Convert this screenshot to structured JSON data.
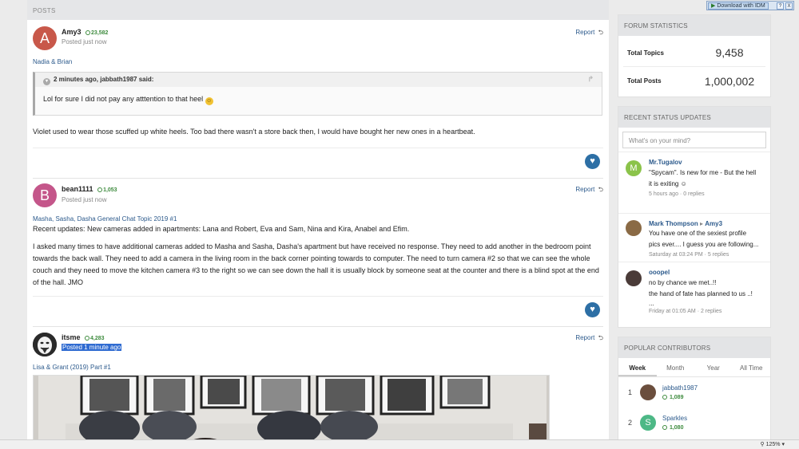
{
  "posts_section": {
    "title": "POSTS"
  },
  "posts": [
    {
      "avatar_letter": "A",
      "avatar_color": "#c8584a",
      "author": "Amy3",
      "reputation": "23,582",
      "posted": "Posted just now",
      "report_label": "Report",
      "topic": "Nadia & Brian",
      "quote": {
        "header": "2 minutes ago, jabbath1987 said:",
        "body": "Lol for sure I did not pay any atttention to that heel"
      },
      "text": "Violet used to wear those scuffed up white heels. Too bad there wasn't a store back then, I would have bought her new ones in a heartbeat."
    },
    {
      "avatar_letter": "B",
      "avatar_color": "#c4568a",
      "author": "bean1111",
      "reputation": "1,053",
      "posted": "Posted just now",
      "report_label": "Report",
      "topic": "Masha, Sasha, Dasha General Chat Topic 2019 #1",
      "text1": "Recent updates: New cameras added in apartments: Lana and Robert, Eva and Sam, Nina and Kira, Anabel and Efim.",
      "text2": "I asked many times to have additional cameras added to Masha and Sasha, Dasha's apartment but have received no response. They need to add another in the bedroom point towards the back wall. They need to add a camera in the living room in the back corner pointing towards to computer. The need to turn camera #2 so that we can see the whole couch and they need to move the kitchen camera #3 to the right so we can see down the hall it is usually block by someone seat at the counter and there is a blind spot at the end of the hall.  JMO"
    },
    {
      "author": "itsme",
      "reputation": "4,283",
      "posted": "Posted 1 minute ago",
      "report_label": "Report",
      "topic": "Lisa & Grant (2019) Part #1"
    }
  ],
  "forum_stats": {
    "title": "FORUM STATISTICS",
    "rows": [
      {
        "label": "Total Topics",
        "value": "9,458"
      },
      {
        "label": "Total Posts",
        "value": "1,000,002"
      }
    ]
  },
  "status_updates": {
    "title": "RECENT STATUS UPDATES",
    "placeholder": "What's on your mind?",
    "items": [
      {
        "name": "Mr.Tugalov",
        "avatar_letter": "M",
        "avatar_color": "#8bc34a",
        "line1": "\"Spycam\". Is new for me - But the hell",
        "line2": "it is exiting",
        "meta": "5 hours ago · 0 replies"
      },
      {
        "name": "Mark Thompson",
        "to": "Amy3",
        "avatar_color": "#8a6a45",
        "line1": "You have one of the sexiest profile",
        "line2": "pics ever.... I guess you are following...",
        "meta": "Saturday at 03:24 PM · 5 replies"
      },
      {
        "name": "ooopel",
        "avatar_color": "#4a3b38",
        "line1": "no by chance we met..!!",
        "line2": "the hand of fate has planned to us ..!",
        "line3": "...",
        "meta": "Friday at 01:05 AM · 2 replies"
      }
    ]
  },
  "contributors": {
    "title": "POPULAR CONTRIBUTORS",
    "tabs": [
      "Week",
      "Month",
      "Year",
      "All Time"
    ],
    "items": [
      {
        "rank": "1",
        "name": "jabbath1987",
        "rep": "1,089",
        "avatar_color": "#6b4e3d"
      },
      {
        "rank": "2",
        "name": "Sparkles",
        "avatar_letter": "S",
        "rep": "1,080",
        "avatar_color": "#4db886"
      }
    ]
  },
  "idm": {
    "label": "Download with IDM",
    "q": "?",
    "x": "X"
  },
  "statusbar": {
    "zoom": "125%"
  }
}
